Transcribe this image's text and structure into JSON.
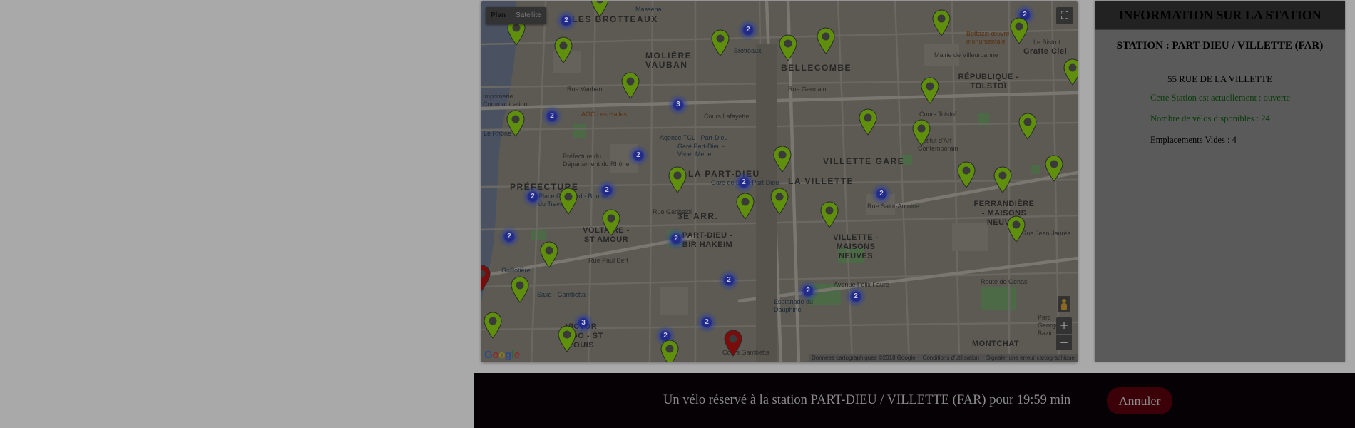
{
  "map": {
    "type_plan": "Plan",
    "type_satellite": "Satellite",
    "fullscreen_glyph": "⛶",
    "zoom_in": "+",
    "zoom_out": "−",
    "google_logo": "Google",
    "attribution": {
      "data": "Données cartographiques ©2018 Google",
      "terms": "Conditions d'utilisation",
      "report": "Signaler une erreur cartographique"
    },
    "labels": {
      "brotteaux_district": "LES BROTTEAUX",
      "moliere_vauban": "MOLIÈRE VAUBAN",
      "bellecombe": "BELLECOMBE",
      "republique_tolstoi": "RÉPUBLIQUE - TOLSTOÏ",
      "villette_gare": "VILLETTE GARE",
      "part_dieu": "LA PART-DIEU",
      "la_villette": "LA VILLETTE",
      "prefecture": "PRÉFECTURE",
      "arr3": "3E ARR.",
      "part_dieu_bir_hakeim": "PART-DIEU - BIR HAKEIM",
      "voltaire_st_amour": "VOLTAIRE - ST AMOUR",
      "villette_maisons_neuves": "VILLETTE - MAISONS NEUVES",
      "ferrandiere": "FERRANDIÈRE - MAISONS NEUVES",
      "victor_hugo": "VICTOR HUGO - ST LOUIS",
      "montchat": "MONTCHAT",
      "massena": "Masséna",
      "brotteaux_metro": "Brotteaux",
      "rue_vauban": "Rue Vauban",
      "cours_lafayette": "Cours Lafayette",
      "aoc_halles": "AOC Les Halles",
      "agence_tcl": "Agence TCL - Part-Dieu",
      "gare_part_dieu_vivier": "Gare Part-Dieu - Vivier Merle",
      "gare_part_dieu": "Gare de Lyon-Part-Dieu",
      "prefecture_rhone": "Préfecture du Département du Rhône",
      "place_guichard": "Place Guichard - Bourse du Travail",
      "guillotiere": "Guillotière",
      "saxe_gambetta": "Saxe - Gambetta",
      "esplanade": "Esplanade du Dauphiné",
      "mairie_villeurbanne": "Mairie de Villeurbanne",
      "bottazzi": "Bottazzi œuvre monumentale",
      "gratte_ciel": "Gratte Ciel",
      "le_bistrot": "Le Bistrot",
      "institut_art": "Institut d'Art Contemporain",
      "parc_georges": "Parc Georges Bazin",
      "rue_saint_antoine": "Rue Saint-Antoine",
      "avenue_felix_faure": "Avenue Félix Faure",
      "route_de_genas": "Route de Genas",
      "rue_jean_jaures": "Rue Jean Jaurès",
      "cours_tolstoi": "Cours Tolstoï",
      "rue_germain": "Rue Germain",
      "rue_paul_bert": "Rue Paul Bert",
      "cours_gambetta": "Cours Gambetta",
      "rue_garibaldi": "Rue Garibaldi",
      "rhone": "Le Rhône",
      "imprimerie": "Imprimerie Communication"
    },
    "clusters": [
      "2",
      "2",
      "2",
      "2",
      "3",
      "2",
      "2",
      "2",
      "2",
      "2",
      "2",
      "2",
      "2",
      "2",
      "3",
      "2",
      "2",
      "2"
    ]
  },
  "station": {
    "header": "INFORMATION SUR LA STATION",
    "name": "STATION : PART-DIEU / VILLETTE (FAR)",
    "address": "55 RUE DE LA VILLETTE",
    "status": "Cette Station est actuellement : ouverte",
    "bikes_available": "Nombre de vélos disponibles : 24",
    "empty_slots": "Emplacements Vides : 4"
  },
  "reservation": {
    "message": "Un vélo réservé à la station PART-DIEU / VILLETTE (FAR) pour 19:59 min",
    "cancel_label": "Annuler"
  },
  "colors": {
    "overlay_background": "#a9a9a9",
    "marker_green": "#5f8f0c",
    "marker_red": "#7a0c0c",
    "cluster_blue": "#1e288c",
    "text_green": "#093c09",
    "cancel_button": "#3b0008"
  },
  "icons": [
    "map-pin-icon",
    "fullscreen-icon",
    "pegman-icon",
    "zoom-in-icon",
    "zoom-out-icon",
    "metro-icon"
  ]
}
